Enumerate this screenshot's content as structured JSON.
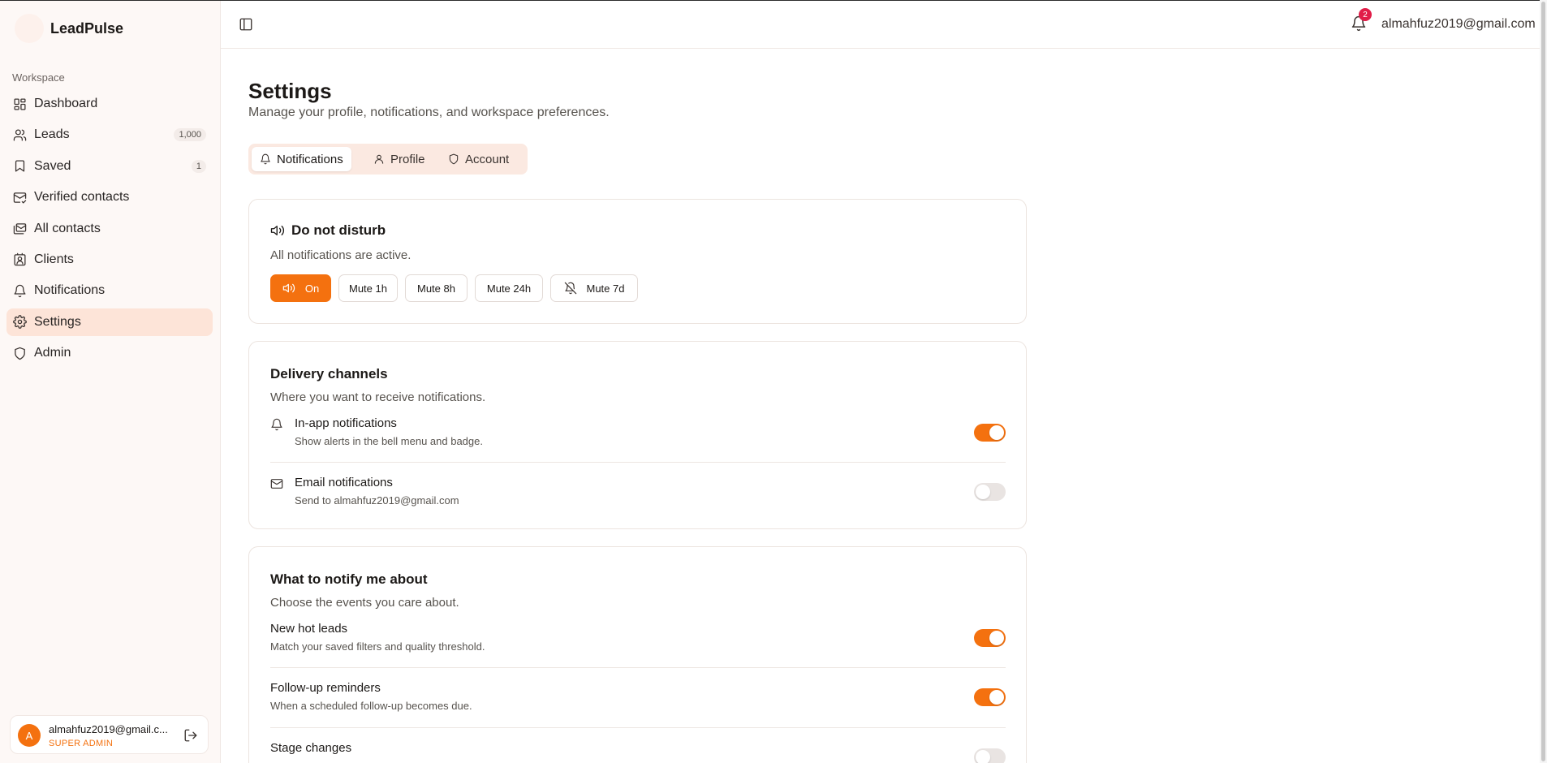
{
  "app": {
    "name": "LeadPulse"
  },
  "sidebar": {
    "section_label": "Workspace",
    "items": [
      {
        "label": "Dashboard",
        "icon": "dashboard-icon",
        "badge": null,
        "active": false
      },
      {
        "label": "Leads",
        "icon": "users-icon",
        "badge": "1,000",
        "active": false
      },
      {
        "label": "Saved",
        "icon": "bookmark-icon",
        "badge": "1",
        "active": false
      },
      {
        "label": "Verified contacts",
        "icon": "mail-check-icon",
        "badge": null,
        "active": false
      },
      {
        "label": "All contacts",
        "icon": "mails-icon",
        "badge": null,
        "active": false
      },
      {
        "label": "Clients",
        "icon": "contact-icon",
        "badge": null,
        "active": false
      },
      {
        "label": "Notifications",
        "icon": "bell-icon",
        "badge": null,
        "active": false
      },
      {
        "label": "Settings",
        "icon": "gear-icon",
        "badge": null,
        "active": true
      },
      {
        "label": "Admin",
        "icon": "shield-icon",
        "badge": null,
        "active": false
      }
    ],
    "user": {
      "avatar_letter": "A",
      "email": "almahfuz2019@gmail.c...",
      "role": "SUPER ADMIN"
    }
  },
  "header": {
    "notification_count": "2",
    "email": "almahfuz2019@gmail.com"
  },
  "page": {
    "title": "Settings",
    "subtitle": "Manage your profile, notifications, and workspace preferences.",
    "tabs": [
      {
        "label": "Notifications",
        "active": true
      },
      {
        "label": "Profile",
        "active": false
      },
      {
        "label": "Account",
        "active": false
      }
    ]
  },
  "dnd": {
    "title": "Do not disturb",
    "status": "All notifications are active.",
    "buttons": [
      "On",
      "Mute 1h",
      "Mute 8h",
      "Mute 24h",
      "Mute 7d"
    ],
    "selected": "On"
  },
  "delivery": {
    "title": "Delivery channels",
    "description": "Where you want to receive notifications.",
    "channels": [
      {
        "title": "In-app notifications",
        "description": "Show alerts in the bell menu and badge.",
        "enabled": true
      },
      {
        "title": "Email notifications",
        "description": "Send to almahfuz2019@gmail.com",
        "enabled": false
      }
    ]
  },
  "events": {
    "title": "What to notify me about",
    "description": "Choose the events you care about.",
    "items": [
      {
        "title": "New hot leads",
        "description": "Match your saved filters and quality threshold.",
        "enabled": true
      },
      {
        "title": "Follow-up reminders",
        "description": "When a scheduled follow-up becomes due.",
        "enabled": true
      },
      {
        "title": "Stage changes",
        "description": "",
        "enabled": false
      }
    ]
  },
  "colors": {
    "accent": "#f4710f",
    "badge_red": "#e11d48",
    "active_nav": "#fde4d8",
    "sidebar_bg": "#fdf8f6"
  }
}
